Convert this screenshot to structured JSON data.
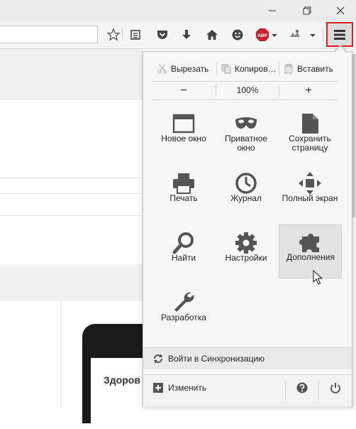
{
  "window": {
    "min_label": "minimize",
    "max_label": "restore",
    "close_label": "close"
  },
  "toolbar": {
    "icons": [
      "star-icon",
      "reading-list-icon",
      "pocket-icon",
      "download-icon",
      "home-icon",
      "emoji-icon",
      "adblock-plus-icon",
      "extension-icon",
      "menu-icon"
    ],
    "abp_text": "ABP"
  },
  "edit": {
    "cut": "Вырезать",
    "copy": "Копиров…",
    "paste": "Вставить"
  },
  "zoom": {
    "minus": "−",
    "level": "100%",
    "plus": "+"
  },
  "grid": [
    {
      "label": "Новое окно",
      "icon": "new-window-icon"
    },
    {
      "label": "Приватное окно",
      "icon": "private-mask-icon"
    },
    {
      "label": "Сохранить страницу",
      "icon": "save-page-icon"
    },
    {
      "label": "Печать",
      "icon": "print-icon"
    },
    {
      "label": "Журнал",
      "icon": "history-clock-icon"
    },
    {
      "label": "Полный экран",
      "icon": "fullscreen-icon"
    },
    {
      "label": "Найти",
      "icon": "find-icon"
    },
    {
      "label": "Настройки",
      "icon": "gear-icon"
    },
    {
      "label": "Дополнения",
      "icon": "puzzle-icon"
    },
    {
      "label": "Разработка",
      "icon": "wrench-icon"
    }
  ],
  "sync": {
    "label": "Войти в Синхронизацию"
  },
  "customize": {
    "label": "Изменить"
  },
  "page": {
    "phone_text": "Здоров"
  },
  "colors": {
    "highlight_border": "#e21b1b",
    "icon_gray": "#555555",
    "panel_bg": "#f7f7f7"
  }
}
